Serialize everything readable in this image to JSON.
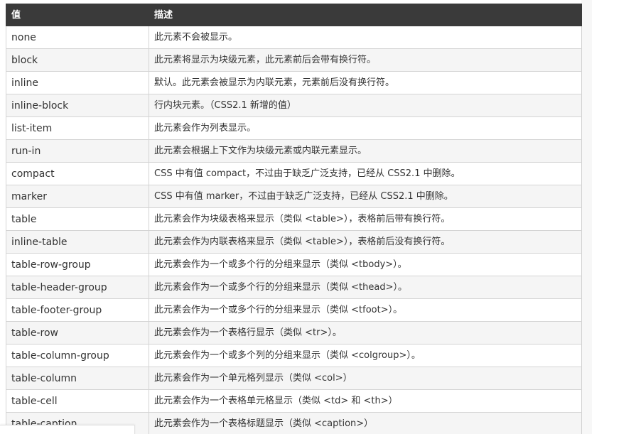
{
  "table": {
    "headers": {
      "value": "值",
      "description": "描述"
    },
    "rows": [
      {
        "value": "none",
        "description": "此元素不会被显示。"
      },
      {
        "value": "block",
        "description": "此元素将显示为块级元素，此元素前后会带有换行符。"
      },
      {
        "value": "inline",
        "description": "默认。此元素会被显示为内联元素，元素前后没有换行符。"
      },
      {
        "value": "inline-block",
        "description": "行内块元素。（CSS2.1 新增的值）"
      },
      {
        "value": "list-item",
        "description": "此元素会作为列表显示。"
      },
      {
        "value": "run-in",
        "description": "此元素会根据上下文作为块级元素或内联元素显示。"
      },
      {
        "value": "compact",
        "description": "CSS 中有值 compact，不过由于缺乏广泛支持，已经从 CSS2.1 中删除。"
      },
      {
        "value": "marker",
        "description": "CSS 中有值 marker，不过由于缺乏广泛支持，已经从 CSS2.1 中删除。"
      },
      {
        "value": "table",
        "description": "此元素会作为块级表格来显示（类似 <table>），表格前后带有换行符。"
      },
      {
        "value": "inline-table",
        "description": "此元素会作为内联表格来显示（类似 <table>），表格前后没有换行符。"
      },
      {
        "value": "table-row-group",
        "description": "此元素会作为一个或多个行的分组来显示（类似 <tbody>）。"
      },
      {
        "value": "table-header-group",
        "description": "此元素会作为一个或多个行的分组来显示（类似 <thead>）。"
      },
      {
        "value": "table-footer-group",
        "description": "此元素会作为一个或多个行的分组来显示（类似 <tfoot>）。"
      },
      {
        "value": "table-row",
        "description": "此元素会作为一个表格行显示（类似 <tr>）。"
      },
      {
        "value": "table-column-group",
        "description": "此元素会作为一个或多个列的分组来显示（类似 <colgroup>）。"
      },
      {
        "value": "table-column",
        "description": "此元素会作为一个单元格列显示（类似 <col>）"
      },
      {
        "value": "table-cell",
        "description": "此元素会作为一个表格单元格显示（类似 <td> 和 <th>）"
      },
      {
        "value": "table-caption",
        "description": "此元素会作为一个表格标题显示（类似 <caption>）"
      }
    ]
  }
}
